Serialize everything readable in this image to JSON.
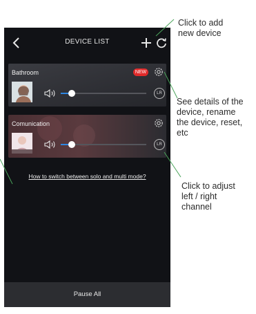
{
  "header": {
    "title": "DEVICE LIST"
  },
  "devices": [
    {
      "name": "Bathroom",
      "badge": "NEW",
      "volume": 0.13,
      "channel_label": "LR"
    },
    {
      "name": "Comunication",
      "badge": "",
      "volume": 0.13,
      "channel_label": "LR"
    }
  ],
  "help_link": "How to switch between solo and multi mode?",
  "footer": {
    "pause_label": "Pause All"
  },
  "annotations": {
    "add_device": "Click to add\nnew device",
    "details": "See details of the\ndevice, rename\nthe device, reset,\netc",
    "channel": "Click to adjust\nleft / right\nchannel"
  },
  "colors": {
    "accent": "#2e86e0",
    "badge": "#e02a2a",
    "background": "#111216",
    "callout_line": "#4aa35a"
  }
}
